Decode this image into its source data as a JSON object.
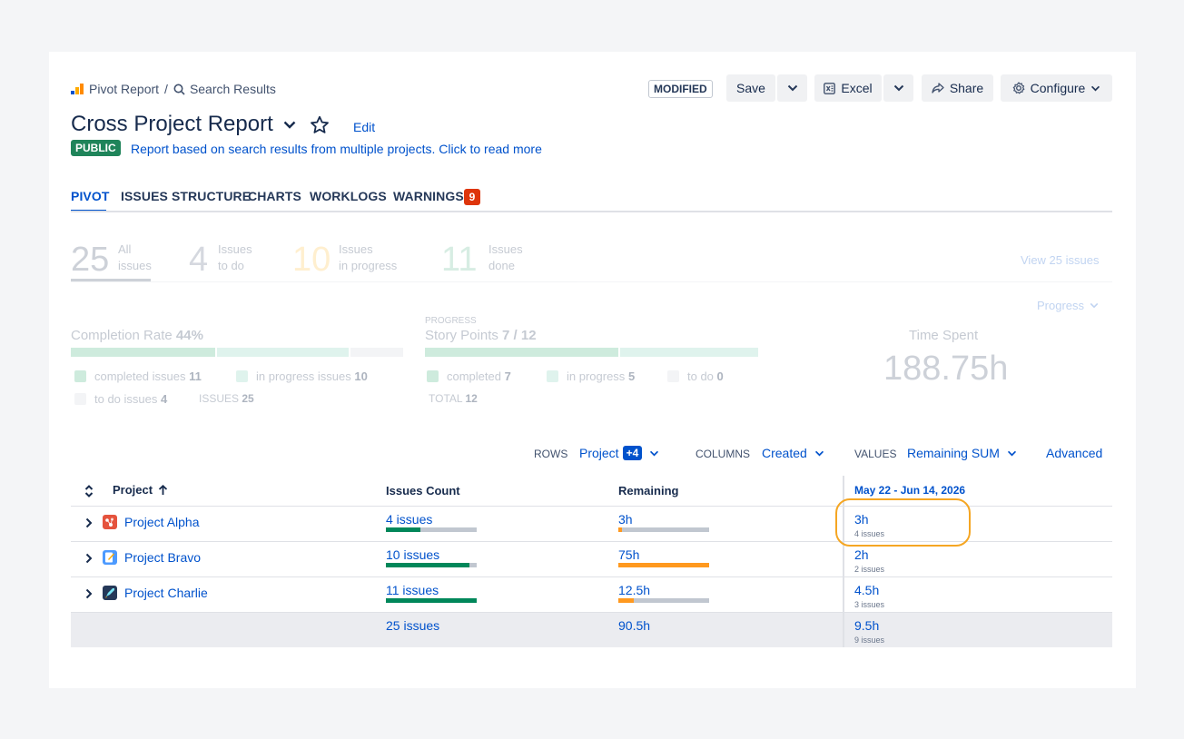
{
  "breadcrumb": {
    "root": "Pivot Report",
    "separator": "/",
    "current": "Search Results"
  },
  "toolbar": {
    "modified_badge": "MODIFIED",
    "save": "Save",
    "excel": "Excel",
    "share": "Share",
    "configure": "Configure"
  },
  "report": {
    "title": "Cross Project Report",
    "edit": "Edit",
    "visibility": "PUBLIC",
    "description": "Report based on search results from multiple projects. Click to read more"
  },
  "tabs": [
    {
      "label": "PIVOT",
      "active": true
    },
    {
      "label": "ISSUES STRUCTURE"
    },
    {
      "label": "CHARTS"
    },
    {
      "label": "WORKLOGS"
    },
    {
      "label": "WARNINGS",
      "badge": "9"
    }
  ],
  "stats": {
    "all": {
      "value": "25",
      "label1": "All",
      "label2": "issues"
    },
    "todo": {
      "value": "4",
      "label1": "Issues",
      "label2": "to do"
    },
    "in_progress": {
      "value": "10",
      "label1": "Issues",
      "label2": "in progress"
    },
    "done": {
      "value": "11",
      "label1": "Issues",
      "label2": "done"
    },
    "view_link": "View 25 issues",
    "progress_dropdown": "Progress"
  },
  "completion": {
    "title": "Completion Rate",
    "percent": "44%",
    "completed_label": "completed issues",
    "completed_value": "11",
    "inprogress_label": "in progress issues",
    "inprogress_value": "10",
    "todo_label": "to do issues",
    "todo_value": "4",
    "issues_label": "ISSUES",
    "issues_value": "25",
    "segments": {
      "completed": 11,
      "in_progress": 10,
      "to_do": 4
    }
  },
  "story_points": {
    "caption": "PROGRESS",
    "title": "Story Points",
    "value": "7 / 12",
    "completed_label": "completed",
    "completed_value": "7",
    "inprogress_label": "in progress",
    "inprogress_value": "5",
    "todo_label": "to do",
    "todo_value": "0",
    "total_label": "TOTAL",
    "total_value": "12",
    "segments": {
      "completed": 7,
      "in_progress": 5,
      "to_do": 0
    }
  },
  "time_spent": {
    "label": "Time Spent",
    "value": "188.75h"
  },
  "config": {
    "rows_label": "ROWS",
    "rows_value": "Project",
    "rows_extra": "+4",
    "columns_label": "COLUMNS",
    "columns_value": "Created",
    "values_label": "VALUES",
    "values_value": "Remaining SUM",
    "advanced": "Advanced"
  },
  "table": {
    "headers": {
      "project": "Project",
      "issues_count": "Issues Count",
      "remaining": "Remaining",
      "date_range": "May 22 - Jun 14, 2026"
    },
    "rows": [
      {
        "project": "Project Alpha",
        "icon": "alpha-project-icon",
        "issues": "4 issues",
        "issues_fill": 0.38,
        "remaining": "3h",
        "remaining_fill": 0.04,
        "date_value": "3h",
        "date_sub": "4 issues"
      },
      {
        "project": "Project Bravo",
        "icon": "bravo-project-icon",
        "issues": "10 issues",
        "issues_fill": 0.92,
        "remaining": "75h",
        "remaining_fill": 1.0,
        "date_value": "2h",
        "date_sub": "2 issues"
      },
      {
        "project": "Project Charlie",
        "icon": "charlie-project-icon",
        "issues": "11 issues",
        "issues_fill": 1.0,
        "remaining": "12.5h",
        "remaining_fill": 0.17,
        "date_value": "4.5h",
        "date_sub": "3 issues"
      }
    ],
    "totals": {
      "issues": "25 issues",
      "remaining": "90.5h",
      "date_value": "9.5h",
      "date_sub": "9 issues"
    }
  },
  "colors": {
    "accent": "#0052cc",
    "done_green": "#00875a",
    "remaining_orange": "#ff991f",
    "public_green": "#1f845a",
    "warning_red": "#de350b",
    "highlight_orange": "#f5a623"
  }
}
